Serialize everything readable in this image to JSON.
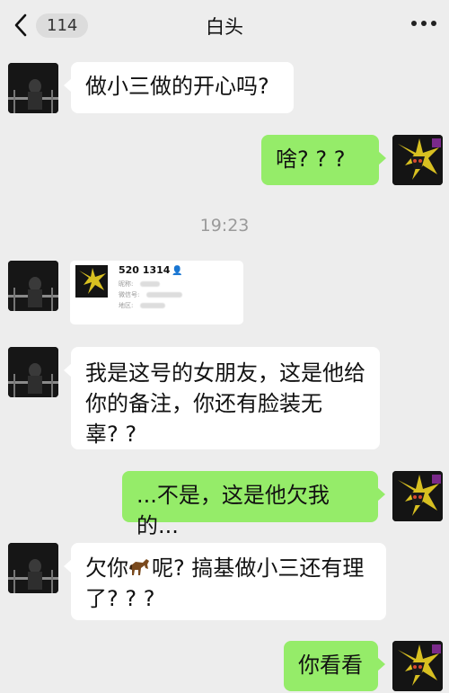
{
  "header": {
    "back_count": "114",
    "title": "白头"
  },
  "timestamp": "19:23",
  "messages": [
    {
      "side": "left",
      "text": "做小三做的开心吗?"
    },
    {
      "side": "right",
      "text": "啥? ? ?"
    },
    {
      "side": "left",
      "type": "contact_card",
      "card": {
        "name": "520 1314",
        "label_nickname": "昵称:",
        "label_wechat_id": "微信号:",
        "label_region": "地区:"
      }
    },
    {
      "side": "left",
      "text_lines": [
        "我是这号的女朋友，这是他给",
        "你的备注，你还有脸装无",
        "辜? ?"
      ]
    },
    {
      "side": "right",
      "text": "...不是，这是他欠我的..."
    },
    {
      "side": "left",
      "text_lines": [
        "欠你",
        "呢? 搞基做小三还有理",
        "了? ? ?"
      ],
      "emoji": "horse-emoji"
    },
    {
      "side": "right",
      "text": "你看看"
    }
  ],
  "colors": {
    "background": "#ededed",
    "incoming_bubble": "#ffffff",
    "outgoing_bubble": "#95ec69"
  }
}
